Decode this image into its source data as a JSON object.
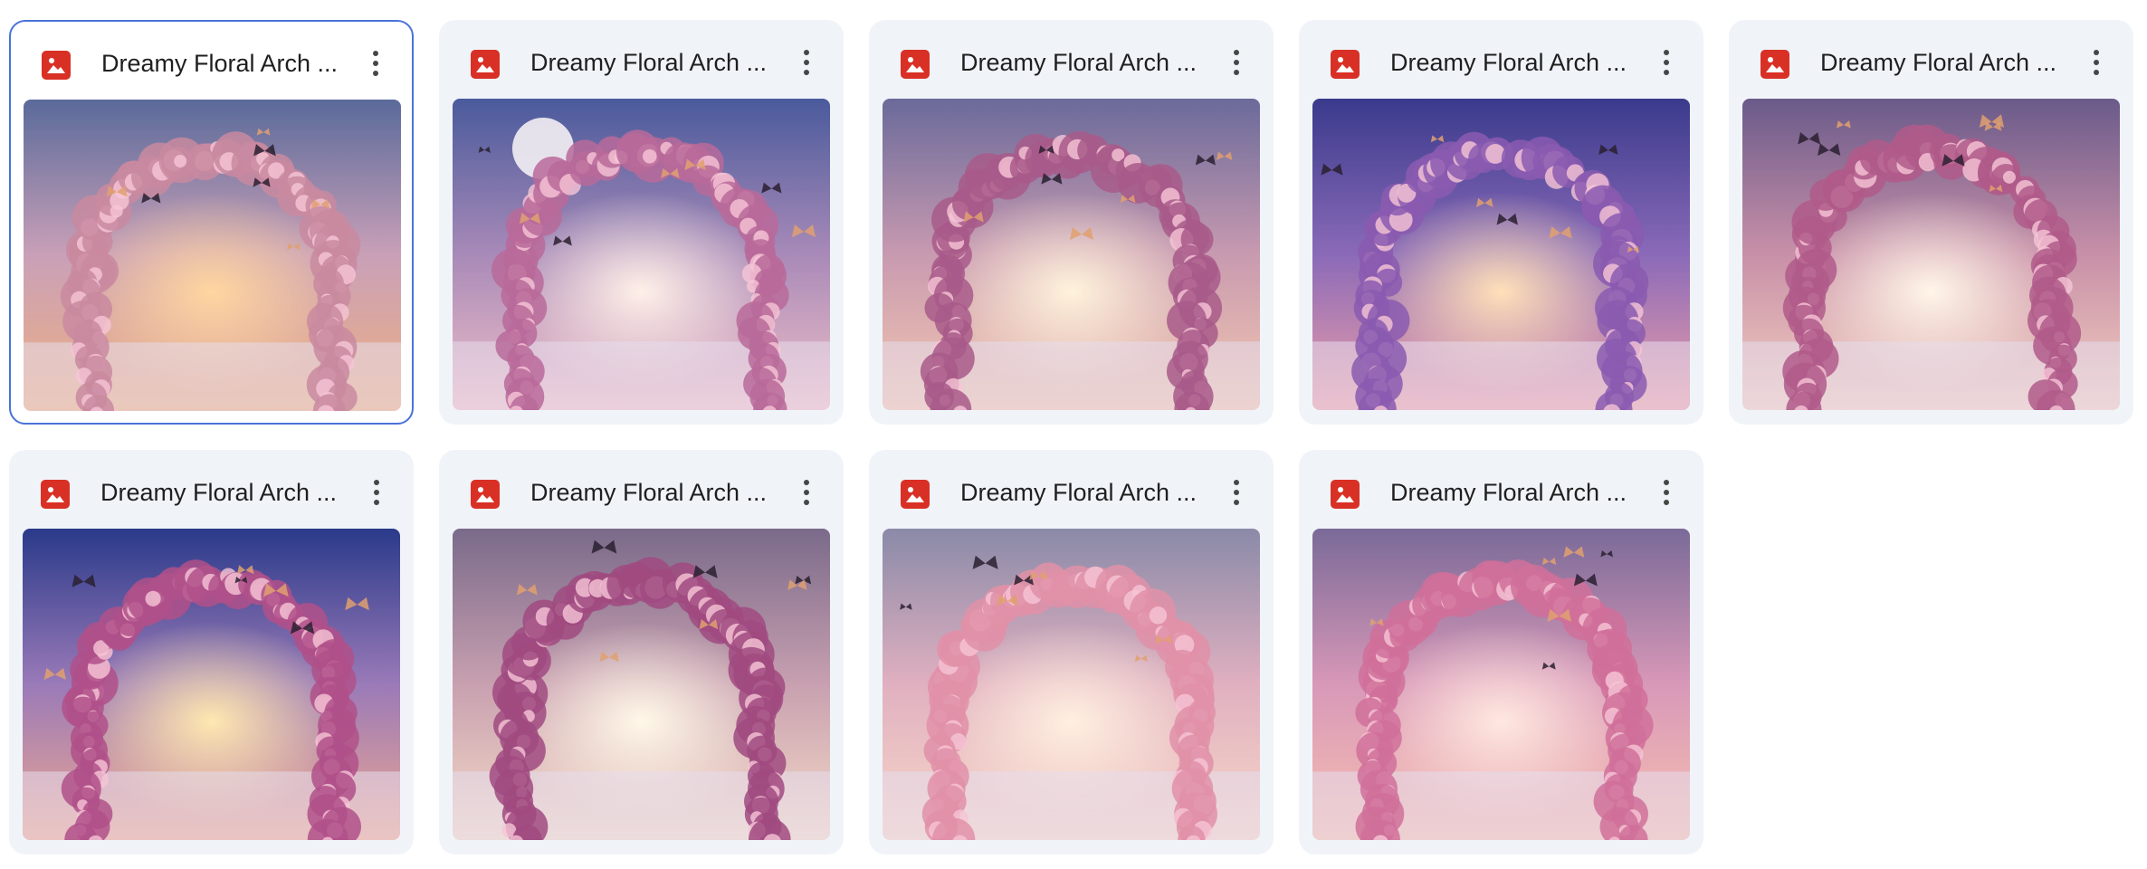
{
  "files": [
    {
      "name": "Dreamy Floral Arch ...",
      "type_icon": "image-file-icon",
      "menu_icon": "more-vert-icon",
      "selected": true,
      "sky": [
        "#5a6a9a",
        "#c9a0b8",
        "#f0b080"
      ],
      "arch": "#c98aa0",
      "glow": "#ffd6a0",
      "has_moon": false
    },
    {
      "name": "Dreamy Floral Arch ...",
      "type_icon": "image-file-icon",
      "menu_icon": "more-vert-icon",
      "selected": false,
      "sky": [
        "#4a5a9c",
        "#a88ab8",
        "#f2c0c8"
      ],
      "arch": "#b96a9a",
      "glow": "#fff0e8",
      "has_moon": true
    },
    {
      "name": "Dreamy Floral Arch ...",
      "type_icon": "image-file-icon",
      "menu_icon": "more-vert-icon",
      "selected": false,
      "sky": [
        "#6a6a9a",
        "#c89ab0",
        "#f4c8b0"
      ],
      "arch": "#a85a8a",
      "glow": "#fff3dc",
      "has_moon": false
    },
    {
      "name": "Dreamy Floral Arch ...",
      "type_icon": "image-file-icon",
      "menu_icon": "more-vert-icon",
      "selected": false,
      "sky": [
        "#3a3a8c",
        "#8a6ab8",
        "#f0a0a8"
      ],
      "arch": "#8a5ab0",
      "glow": "#ffe0b8",
      "has_moon": false
    },
    {
      "name": "Dreamy Floral Arch ...",
      "type_icon": "image-file-icon",
      "menu_icon": "more-vert-icon",
      "selected": false,
      "sky": [
        "#6a5a8a",
        "#c890a8",
        "#f4d0c0"
      ],
      "arch": "#b05a8a",
      "glow": "#fff6e8",
      "has_moon": false
    },
    {
      "name": "Dreamy Floral Arch ...",
      "type_icon": "image-file-icon",
      "menu_icon": "more-vert-icon",
      "selected": false,
      "sky": [
        "#2a3a8a",
        "#9a7ab8",
        "#f0a890"
      ],
      "arch": "#b0508a",
      "glow": "#ffe8b0",
      "has_moon": false
    },
    {
      "name": "Dreamy Floral Arch ...",
      "type_icon": "image-file-icon",
      "menu_icon": "more-vert-icon",
      "selected": false,
      "sky": [
        "#7a6a8a",
        "#c8a0b0",
        "#f6dcc8"
      ],
      "arch": "#a04a80",
      "glow": "#fff8e8",
      "has_moon": false
    },
    {
      "name": "Dreamy Floral Arch ...",
      "type_icon": "image-file-icon",
      "menu_icon": "more-vert-icon",
      "selected": false,
      "sky": [
        "#8a8aa8",
        "#e0b0c0",
        "#f8d8c8"
      ],
      "arch": "#e090a8",
      "glow": "#fff0e0",
      "has_moon": false
    },
    {
      "name": "Dreamy Floral Arch ...",
      "type_icon": "image-file-icon",
      "menu_icon": "more-vert-icon",
      "selected": false,
      "sky": [
        "#7a6a98",
        "#d898b8",
        "#f8c0b0"
      ],
      "arch": "#d0709a",
      "glow": "#ffe8e0",
      "has_moon": false
    }
  ],
  "colors": {
    "tile_bg": "#f0f4f9",
    "selected_border": "#4a73d8",
    "title_text": "#1f1f1f",
    "icon_red": "#d93025"
  }
}
